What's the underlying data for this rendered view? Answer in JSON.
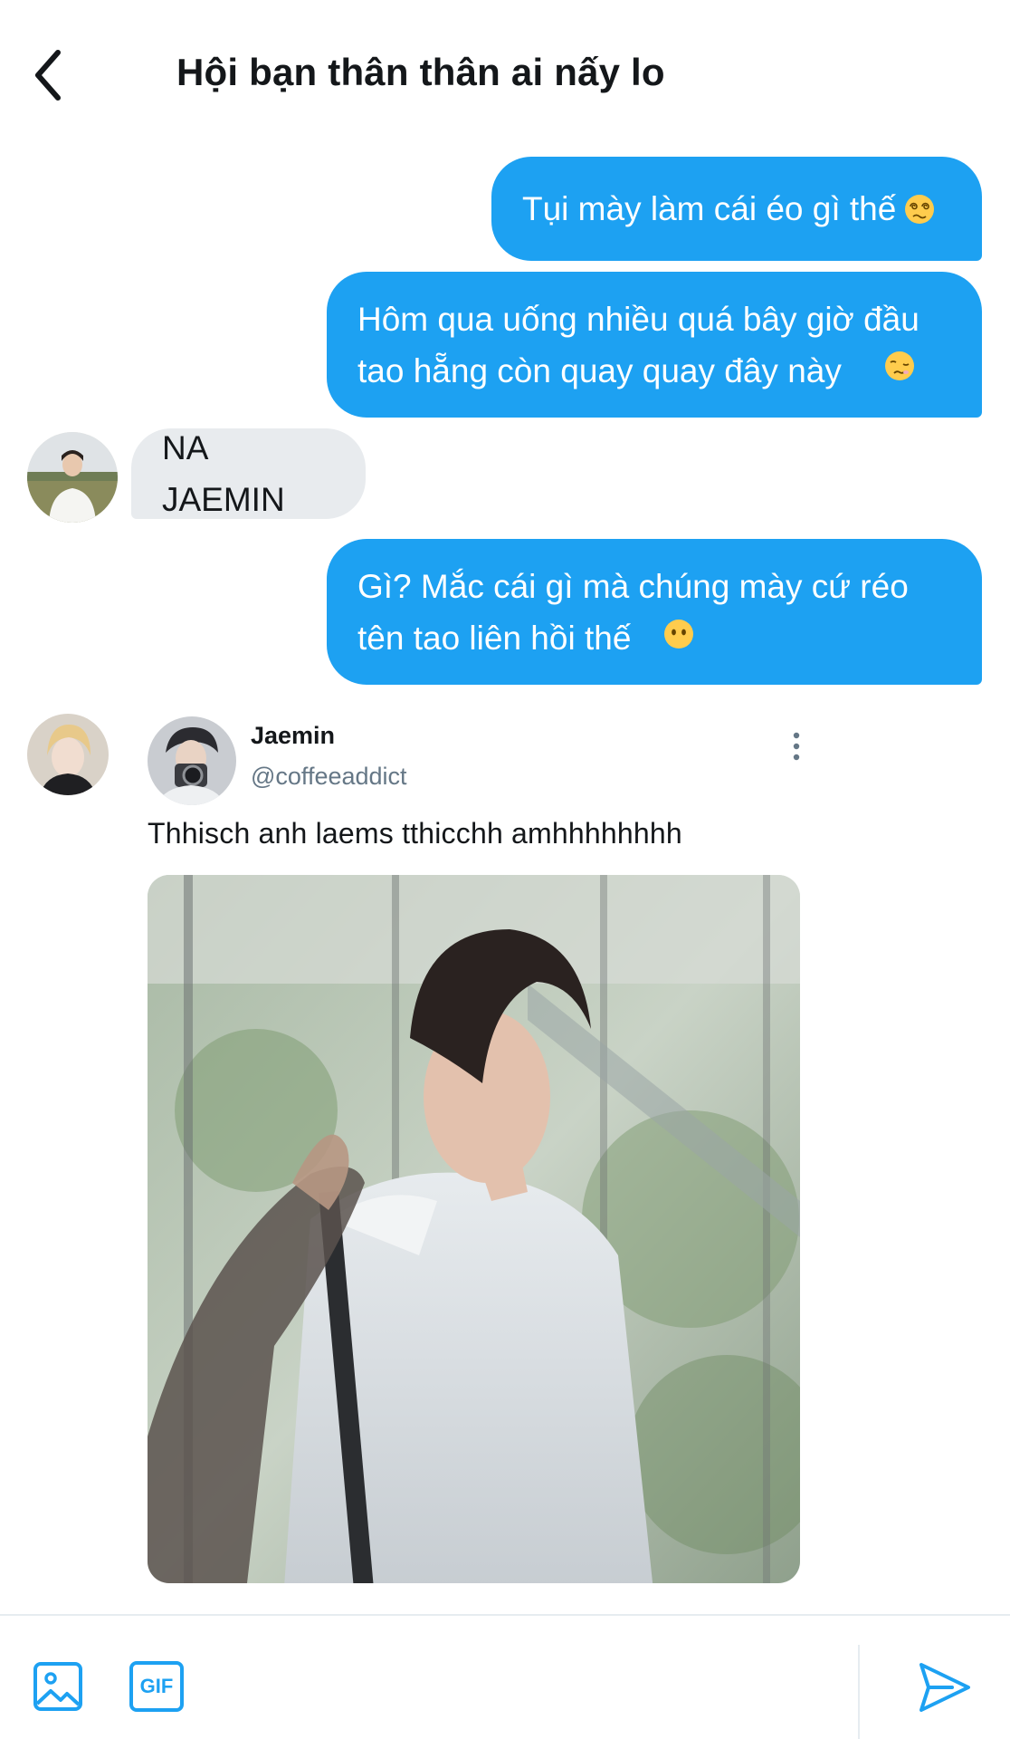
{
  "header": {
    "title": "Hội bạn thân thân ai nấy lo",
    "back_icon": "chevron-left-icon"
  },
  "messages": [
    {
      "side": "out",
      "text": "Tụi mày làm cái éo gì thế",
      "emoji": "dizzy-face-emoji"
    },
    {
      "side": "out",
      "text": "Hôm qua uống nhiều quá bây giờ đầu\ntao hẵng còn quay quay đây này",
      "emoji": "woozy-face-emoji"
    },
    {
      "side": "in",
      "text": "NA JAEMIN"
    },
    {
      "side": "out",
      "text": "Gì? Mắc cái gì mà chúng mày cứ réo\ntên tao liên hồi thế",
      "emoji": "no-mouth-face-emoji"
    }
  ],
  "tweet": {
    "name": "Jaemin",
    "handle": "@coffeeaddict",
    "text": "Thhisch anh laems tthicchh amhhhhhhhh",
    "more_icon": "more-vertical-icon"
  },
  "composer": {
    "image_icon": "image-icon",
    "gif_label": "GIF",
    "send_icon": "send-icon"
  },
  "colors": {
    "accent": "#1da1f2",
    "incoming_bubble": "#e8ebee",
    "text": "#14171a",
    "secondary_text": "#657786"
  }
}
